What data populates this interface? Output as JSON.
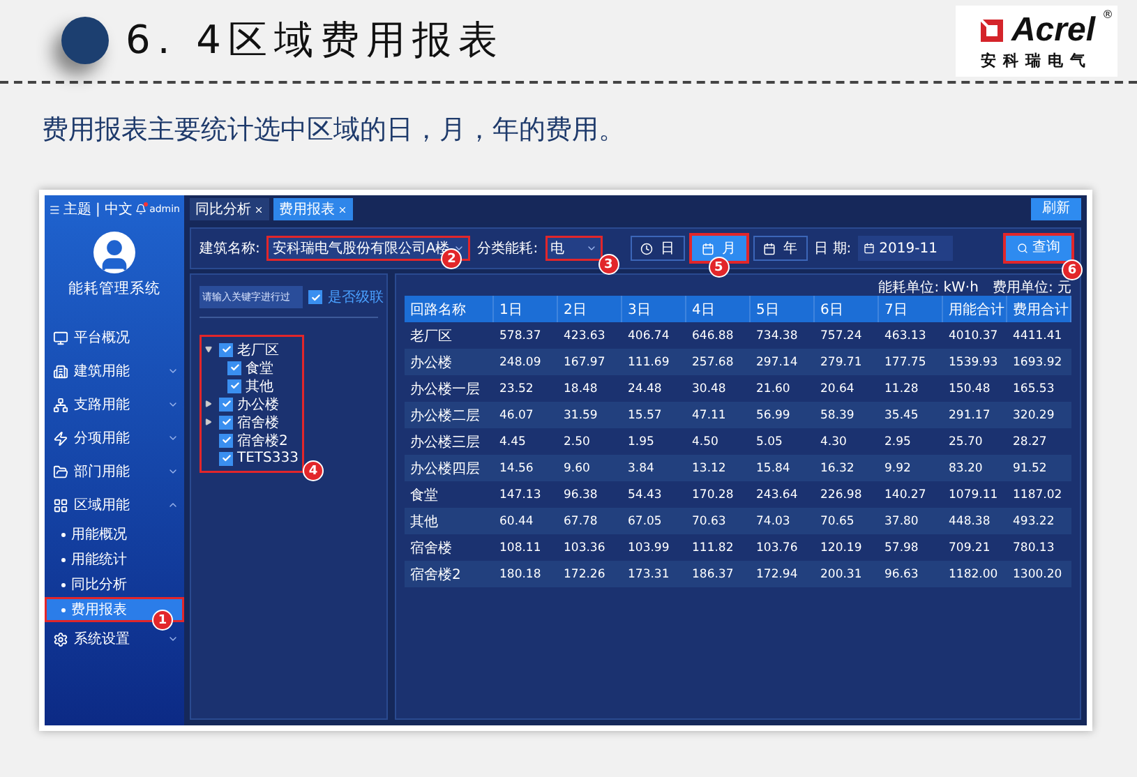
{
  "page": {
    "heading": "6. 4区域费用报表",
    "logo": {
      "name": "Acrel",
      "trademark": "®",
      "tagline": "安科瑞电气"
    },
    "intro": "费用报表主要统计选中区域的日，月，年的费用。"
  },
  "topbar": {
    "menu_label": "主题 | 中文",
    "user": "admin",
    "has_alert": true
  },
  "sidebar": {
    "system_name": "能耗管理系统",
    "items": [
      {
        "label": "平台概况",
        "kind": "link"
      },
      {
        "label": "建筑用能",
        "kind": "group",
        "expanded": false
      },
      {
        "label": "支路用能",
        "kind": "group",
        "expanded": false
      },
      {
        "label": "分项用能",
        "kind": "group",
        "expanded": false
      },
      {
        "label": "部门用能",
        "kind": "group",
        "expanded": false
      },
      {
        "label": "区域用能",
        "kind": "group",
        "expanded": true,
        "children": [
          {
            "label": "用能概况",
            "selected": false
          },
          {
            "label": "用能统计",
            "selected": false
          },
          {
            "label": "同比分析",
            "selected": false
          },
          {
            "label": "费用报表",
            "selected": true,
            "callout": "1"
          }
        ]
      },
      {
        "label": "系统设置",
        "kind": "group",
        "expanded": false
      }
    ]
  },
  "tabs": [
    {
      "label": "同比分析",
      "selected": false
    },
    {
      "label": "费用报表",
      "selected": true
    }
  ],
  "refresh": "刷新",
  "filters": {
    "building": {
      "label": "建筑名称:",
      "value": "安科瑞电气股份有限公司A楼",
      "callout": "2"
    },
    "category": {
      "label": "分类能耗:",
      "value": "电",
      "callout": "3"
    },
    "periods": [
      {
        "label": "日",
        "kind": "clock",
        "selected": false
      },
      {
        "label": "月",
        "kind": "calendar",
        "selected": true,
        "callout": "5"
      },
      {
        "label": "年",
        "kind": "calendar",
        "selected": false
      }
    ],
    "date": {
      "label": "日 期:",
      "value": "2019-11"
    },
    "query": {
      "label": "查询",
      "callout": "6"
    }
  },
  "tree_panel": {
    "search": {
      "placeholder": "请输入关键字进行过"
    },
    "cascade": {
      "label": "是否级联",
      "checked": true
    },
    "callout": "4",
    "nodes": [
      {
        "label": "老厂区",
        "checked": true,
        "expanded": true,
        "children": [
          {
            "label": "食堂",
            "checked": true
          },
          {
            "label": "其他",
            "checked": true
          }
        ]
      },
      {
        "label": "办公楼",
        "checked": true,
        "expanded": false
      },
      {
        "label": "宿舍楼",
        "checked": true,
        "expanded": false
      },
      {
        "label": "宿舍楼2",
        "checked": true
      },
      {
        "label": "TETS333",
        "checked": true
      }
    ]
  },
  "table": {
    "units": [
      "能耗单位: kW·h",
      "费用单位: 元"
    ],
    "columns": [
      "回路名称",
      "1日",
      "2日",
      "3日",
      "4日",
      "5日",
      "6日",
      "7日",
      "用能合计",
      "费用合计"
    ],
    "rows": [
      [
        "老厂区",
        "578.37",
        "423.63",
        "406.74",
        "646.88",
        "734.38",
        "757.24",
        "463.13",
        "4010.37",
        "4411.41"
      ],
      [
        "办公楼",
        "248.09",
        "167.97",
        "111.69",
        "257.68",
        "297.14",
        "279.71",
        "177.75",
        "1539.93",
        "1693.92"
      ],
      [
        "办公楼一层",
        "23.52",
        "18.48",
        "24.48",
        "30.48",
        "21.60",
        "20.64",
        "11.28",
        "150.48",
        "165.53"
      ],
      [
        "办公楼二层",
        "46.07",
        "31.59",
        "15.57",
        "47.11",
        "56.99",
        "58.39",
        "35.45",
        "291.17",
        "320.29"
      ],
      [
        "办公楼三层",
        "4.45",
        "2.50",
        "1.95",
        "4.50",
        "5.05",
        "4.30",
        "2.95",
        "25.70",
        "28.27"
      ],
      [
        "办公楼四层",
        "14.56",
        "9.60",
        "3.84",
        "13.12",
        "15.84",
        "16.32",
        "9.92",
        "83.20",
        "91.52"
      ],
      [
        "食堂",
        "147.13",
        "96.38",
        "54.43",
        "170.28",
        "243.64",
        "226.98",
        "140.27",
        "1079.11",
        "1187.02"
      ],
      [
        "其他",
        "60.44",
        "67.78",
        "67.05",
        "70.63",
        "74.03",
        "70.65",
        "37.80",
        "448.38",
        "493.22"
      ],
      [
        "宿舍楼",
        "108.11",
        "103.36",
        "103.99",
        "111.82",
        "103.76",
        "120.19",
        "57.98",
        "709.21",
        "780.13"
      ],
      [
        "宿舍楼2",
        "180.18",
        "172.26",
        "173.31",
        "186.37",
        "172.94",
        "200.31",
        "96.63",
        "1182.00",
        "1300.20"
      ]
    ]
  }
}
